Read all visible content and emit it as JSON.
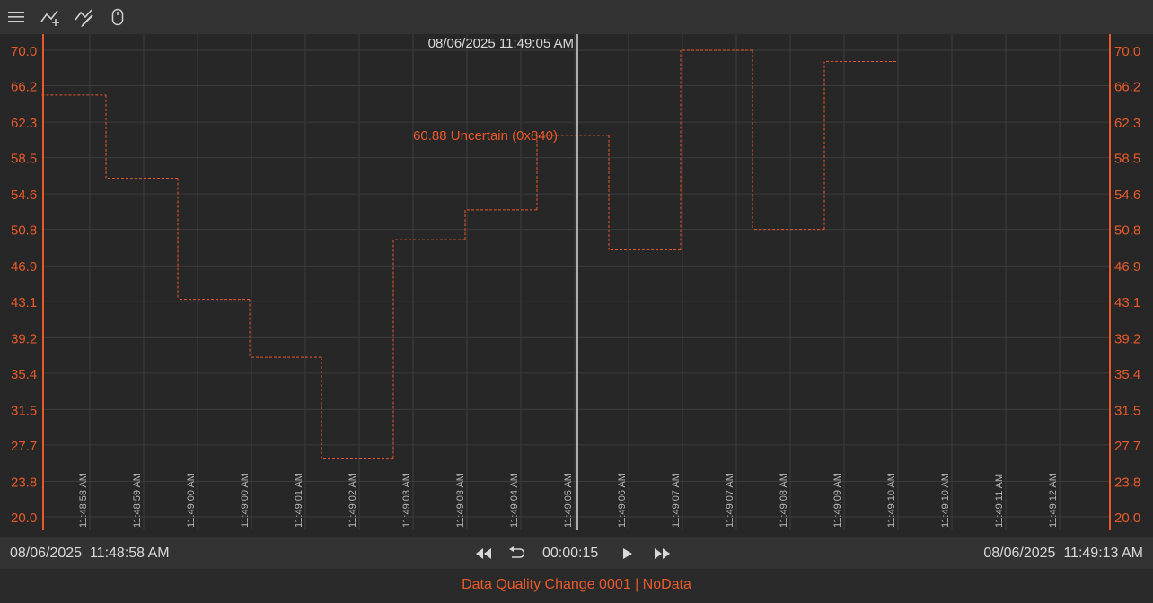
{
  "toolbar": {
    "icons": [
      "menu-icon",
      "add-trend-icon",
      "edit-trend-icon",
      "mouse-icon"
    ]
  },
  "colors": {
    "accent": "#e85a2a",
    "grid": "#3c3c3c",
    "background": "#272727",
    "cursor_line": "#d8d8d8"
  },
  "chart_data": {
    "type": "line",
    "step": true,
    "line_style": "dashed",
    "cursor_timestamp": "08/06/2025 11:49:05 AM",
    "cursor_annotation": "60.88 Uncertain (0x840)",
    "y_ticks_left": [
      "70.0",
      "66.2",
      "62.3",
      "58.5",
      "54.6",
      "50.8",
      "46.9",
      "43.1",
      "39.2",
      "35.4",
      "31.5",
      "27.7",
      "23.8",
      "20.0"
    ],
    "y_ticks_right": [
      "70.0",
      "66.2",
      "62.3",
      "58.5",
      "54.6",
      "50.8",
      "46.9",
      "43.1",
      "39.2",
      "35.4",
      "31.5",
      "27.7",
      "23.8",
      "20.0"
    ],
    "ylim": [
      20.0,
      70.0
    ],
    "x_ticks": [
      "11:48:58 AM",
      "11:48:59 AM",
      "11:49:00 AM",
      "11:49:00 AM",
      "11:49:01 AM",
      "11:49:02 AM",
      "11:49:03 AM",
      "11:49:03 AM",
      "11:49:04 AM",
      "11:49:05 AM",
      "11:49:06 AM",
      "11:49:07 AM",
      "11:49:07 AM",
      "11:49:08 AM",
      "11:49:09 AM",
      "11:49:10 AM",
      "11:49:10 AM",
      "11:49:11 AM",
      "11:49:12 AM"
    ],
    "xlim_seconds": [
      0,
      15
    ],
    "series": [
      {
        "segments": [
          {
            "t0": 0.08,
            "t1": 1.0,
            "value": 65.2
          },
          {
            "t0": 1.0,
            "t1": 2.0,
            "value": 56.3
          },
          {
            "t0": 2.0,
            "t1": 3.0,
            "value": 43.3
          },
          {
            "t0": 3.0,
            "t1": 4.0,
            "value": 37.1
          },
          {
            "t0": 4.0,
            "t1": 5.0,
            "value": 26.3
          },
          {
            "t0": 5.0,
            "t1": 6.0,
            "value": 49.7
          },
          {
            "t0": 6.0,
            "t1": 7.0,
            "value": 52.9
          },
          {
            "t0": 7.0,
            "t1": 8.0,
            "value": 60.88
          },
          {
            "t0": 8.0,
            "t1": 9.0,
            "value": 48.6
          },
          {
            "t0": 9.0,
            "t1": 10.0,
            "value": 70.0
          },
          {
            "t0": 10.0,
            "t1": 11.0,
            "value": 50.8
          },
          {
            "t0": 11.0,
            "t1": 12.0,
            "value": 68.8
          }
        ]
      }
    ]
  },
  "footer": {
    "start_date": "08/06/2025",
    "start_time": "11:48:58 AM",
    "duration": "00:00:15",
    "end_date": "08/06/2025",
    "end_time": "11:49:13 AM",
    "controls": [
      "rewind-icon",
      "undo-icon",
      "play-icon",
      "fast-forward-icon"
    ]
  },
  "status": {
    "text": "Data Quality Change 0001 | NoData"
  }
}
